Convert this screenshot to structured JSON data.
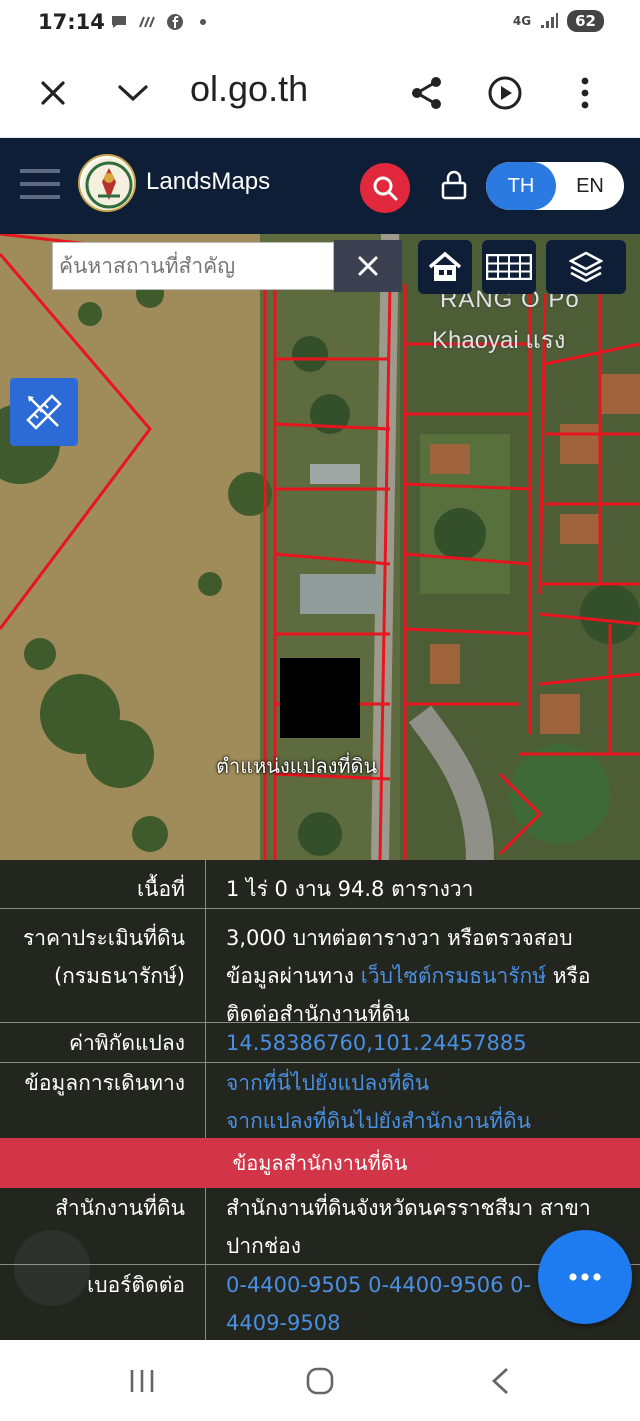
{
  "status": {
    "time": "17:14",
    "network": "4G",
    "battery": "62"
  },
  "browser": {
    "url": "ol.go.th"
  },
  "header": {
    "brand": "LandsMaps",
    "lang_th": "TH",
    "lang_en": "EN"
  },
  "map": {
    "search_placeholder": "ค้นหาสถานที่สำคัญ",
    "parcel_label": "ตำแหน่งแปลงที่ดิน",
    "label_line1": "RANG O Po",
    "label_line2": "Khaoyai แรง"
  },
  "info": {
    "area_key": "เนื้อที่",
    "area_value": "1 ไร่ 0 งาน 94.8 ตารางวา",
    "price_key_line1": "ราคาประเมินที่ดิน",
    "price_key_line2": "(กรมธนารักษ์)",
    "price_line1": "3,000 บาทต่อตารางวา หรือตรวจสอบ",
    "price_line2_pre": "ข้อมูลผ่านทาง ",
    "price_line2_link": "เว็บไซต์กรมธนารักษ์",
    "price_line2_post": " หรือ",
    "price_line3": "ติดต่อสำนักงานที่ดิน",
    "coord_key": "ค่าพิกัดแปลง",
    "coord_value": "14.58386760,101.24457885",
    "travel_key": "ข้อมูลการเดินทาง",
    "travel_link1": "จากที่นี่ไปยังแปลงที่ดิน",
    "travel_link2": "จากแปลงที่ดินไปยังสำนักงานที่ดิน",
    "section_title": "ข้อมูลสำนักงานที่ดิน",
    "office_key": "สำนักงานที่ดิน",
    "office_line1": "สำนักงานที่ดินจังหวัดนครราชสีมา สาขา",
    "office_line2": "ปากช่อง",
    "phone_key": "เบอร์ติดต่อ",
    "phone_line1": "0-4400-9505 0-4400-9506 0-",
    "phone_line2": "4409-9508"
  },
  "colors": {
    "header": "#0e1e36",
    "accent_red": "#e1283c",
    "accent_blue": "#2a7ae2",
    "link": "#4a90e2",
    "panel": "#23251f"
  },
  "icons": [
    "close-icon",
    "chevron-down-icon",
    "share-icon",
    "play-icon",
    "more-vert-icon",
    "menu-icon",
    "search-icon",
    "lock-icon",
    "home-icon",
    "grid-icon",
    "layers-icon",
    "ruler-pencil-icon",
    "more-horiz-icon"
  ]
}
